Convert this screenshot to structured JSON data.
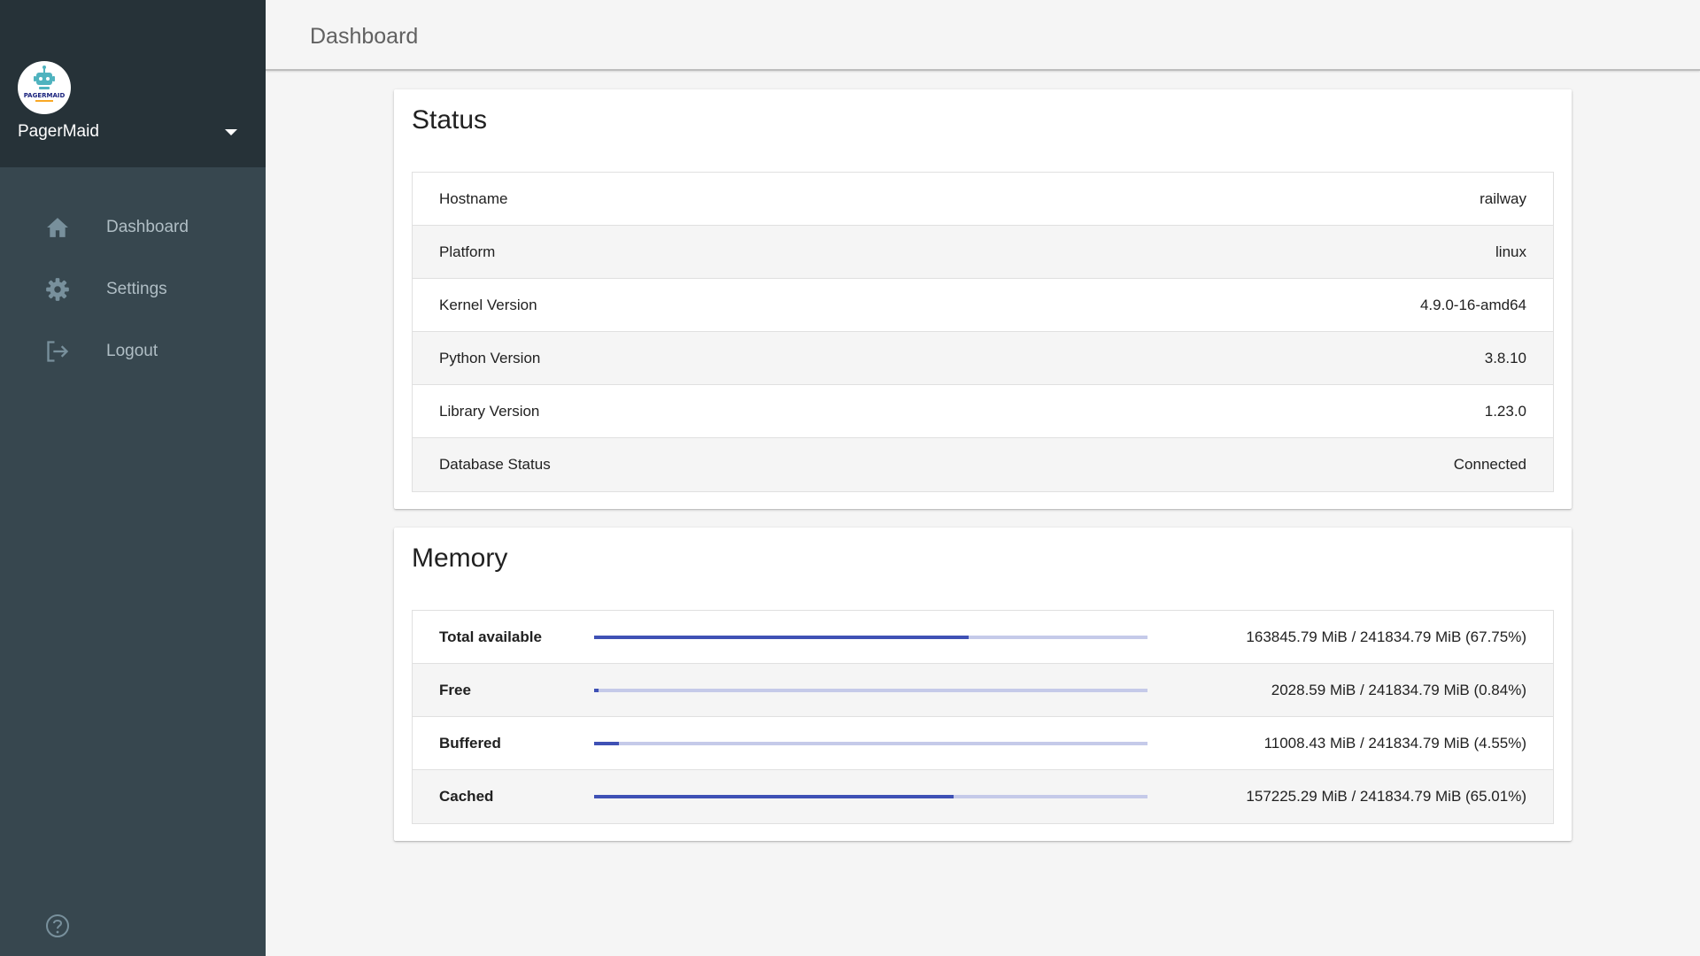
{
  "sidebar": {
    "account_name": "PagerMaid",
    "logo_text": "PAGERMAID",
    "items": [
      {
        "label": "Dashboard",
        "icon": "home-icon"
      },
      {
        "label": "Settings",
        "icon": "gear-icon"
      },
      {
        "label": "Logout",
        "icon": "logout-icon"
      }
    ],
    "help_icon": "help-icon"
  },
  "header": {
    "title": "Dashboard"
  },
  "status": {
    "title": "Status",
    "rows": [
      {
        "label": "Hostname",
        "value": "railway"
      },
      {
        "label": "Platform",
        "value": "linux"
      },
      {
        "label": "Kernel Version",
        "value": "4.9.0-16-amd64"
      },
      {
        "label": "Python Version",
        "value": "3.8.10"
      },
      {
        "label": "Library Version",
        "value": "1.23.0"
      },
      {
        "label": "Database Status",
        "value": "Connected"
      }
    ]
  },
  "memory": {
    "title": "Memory",
    "rows": [
      {
        "label": "Total available",
        "value": "163845.79 MiB / 241834.79 MiB (67.75%)",
        "percent": 67.75
      },
      {
        "label": "Free",
        "value": "2028.59 MiB / 241834.79 MiB (0.84%)",
        "percent": 0.84
      },
      {
        "label": "Buffered",
        "value": "11008.43 MiB / 241834.79 MiB (4.55%)",
        "percent": 4.55
      },
      {
        "label": "Cached",
        "value": "157225.29 MiB / 241834.79 MiB (65.01%)",
        "percent": 65.01
      }
    ]
  },
  "colors": {
    "sidebar_bg": "#37474f",
    "sidebar_header_bg": "#263238",
    "accent": "#3f51b5",
    "accent_light": "#c5cae9"
  }
}
